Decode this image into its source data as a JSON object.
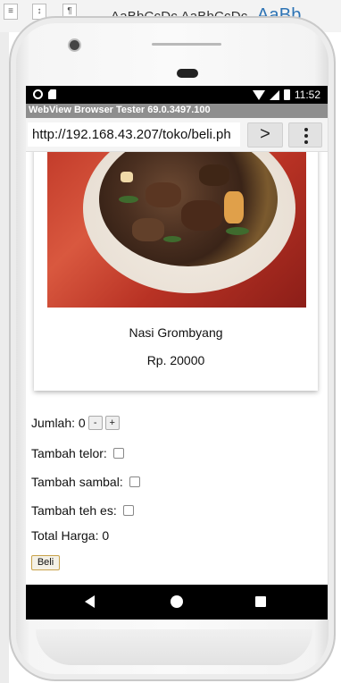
{
  "background_app": {
    "style_sample_text": "AaBbCcDc AaBbCcDc",
    "style_sample_large": "AaBb",
    "accent_color": "#2e74b5"
  },
  "status_bar": {
    "time": "11:52",
    "icons": [
      "circle-notification-icon",
      "sd-card-icon",
      "wifi-icon",
      "signal-icon",
      "battery-icon"
    ]
  },
  "app_bar": {
    "title": "WebView Browser Tester 69.0.3497.100"
  },
  "url_bar": {
    "url": "http://192.168.43.207/toko/beli.ph",
    "go_label": ">",
    "menu_icon": "kebab-menu-icon"
  },
  "product": {
    "name": "Nasi Grombyang",
    "price": "Rp. 20000",
    "image_icon": "food-photo"
  },
  "form": {
    "qty_label": "Jumlah: 0",
    "minus_label": "-",
    "plus_label": "+",
    "egg_label": "Tambah telor:",
    "sambal_label": "Tambah sambal:",
    "tea_label": "Tambah teh es:",
    "egg_checked": false,
    "sambal_checked": false,
    "tea_checked": false,
    "total_label": "Total Harga: 0",
    "buy_label": "Beli"
  },
  "nav_bar": {
    "icons": [
      "back-icon",
      "home-icon",
      "recents-icon"
    ]
  }
}
